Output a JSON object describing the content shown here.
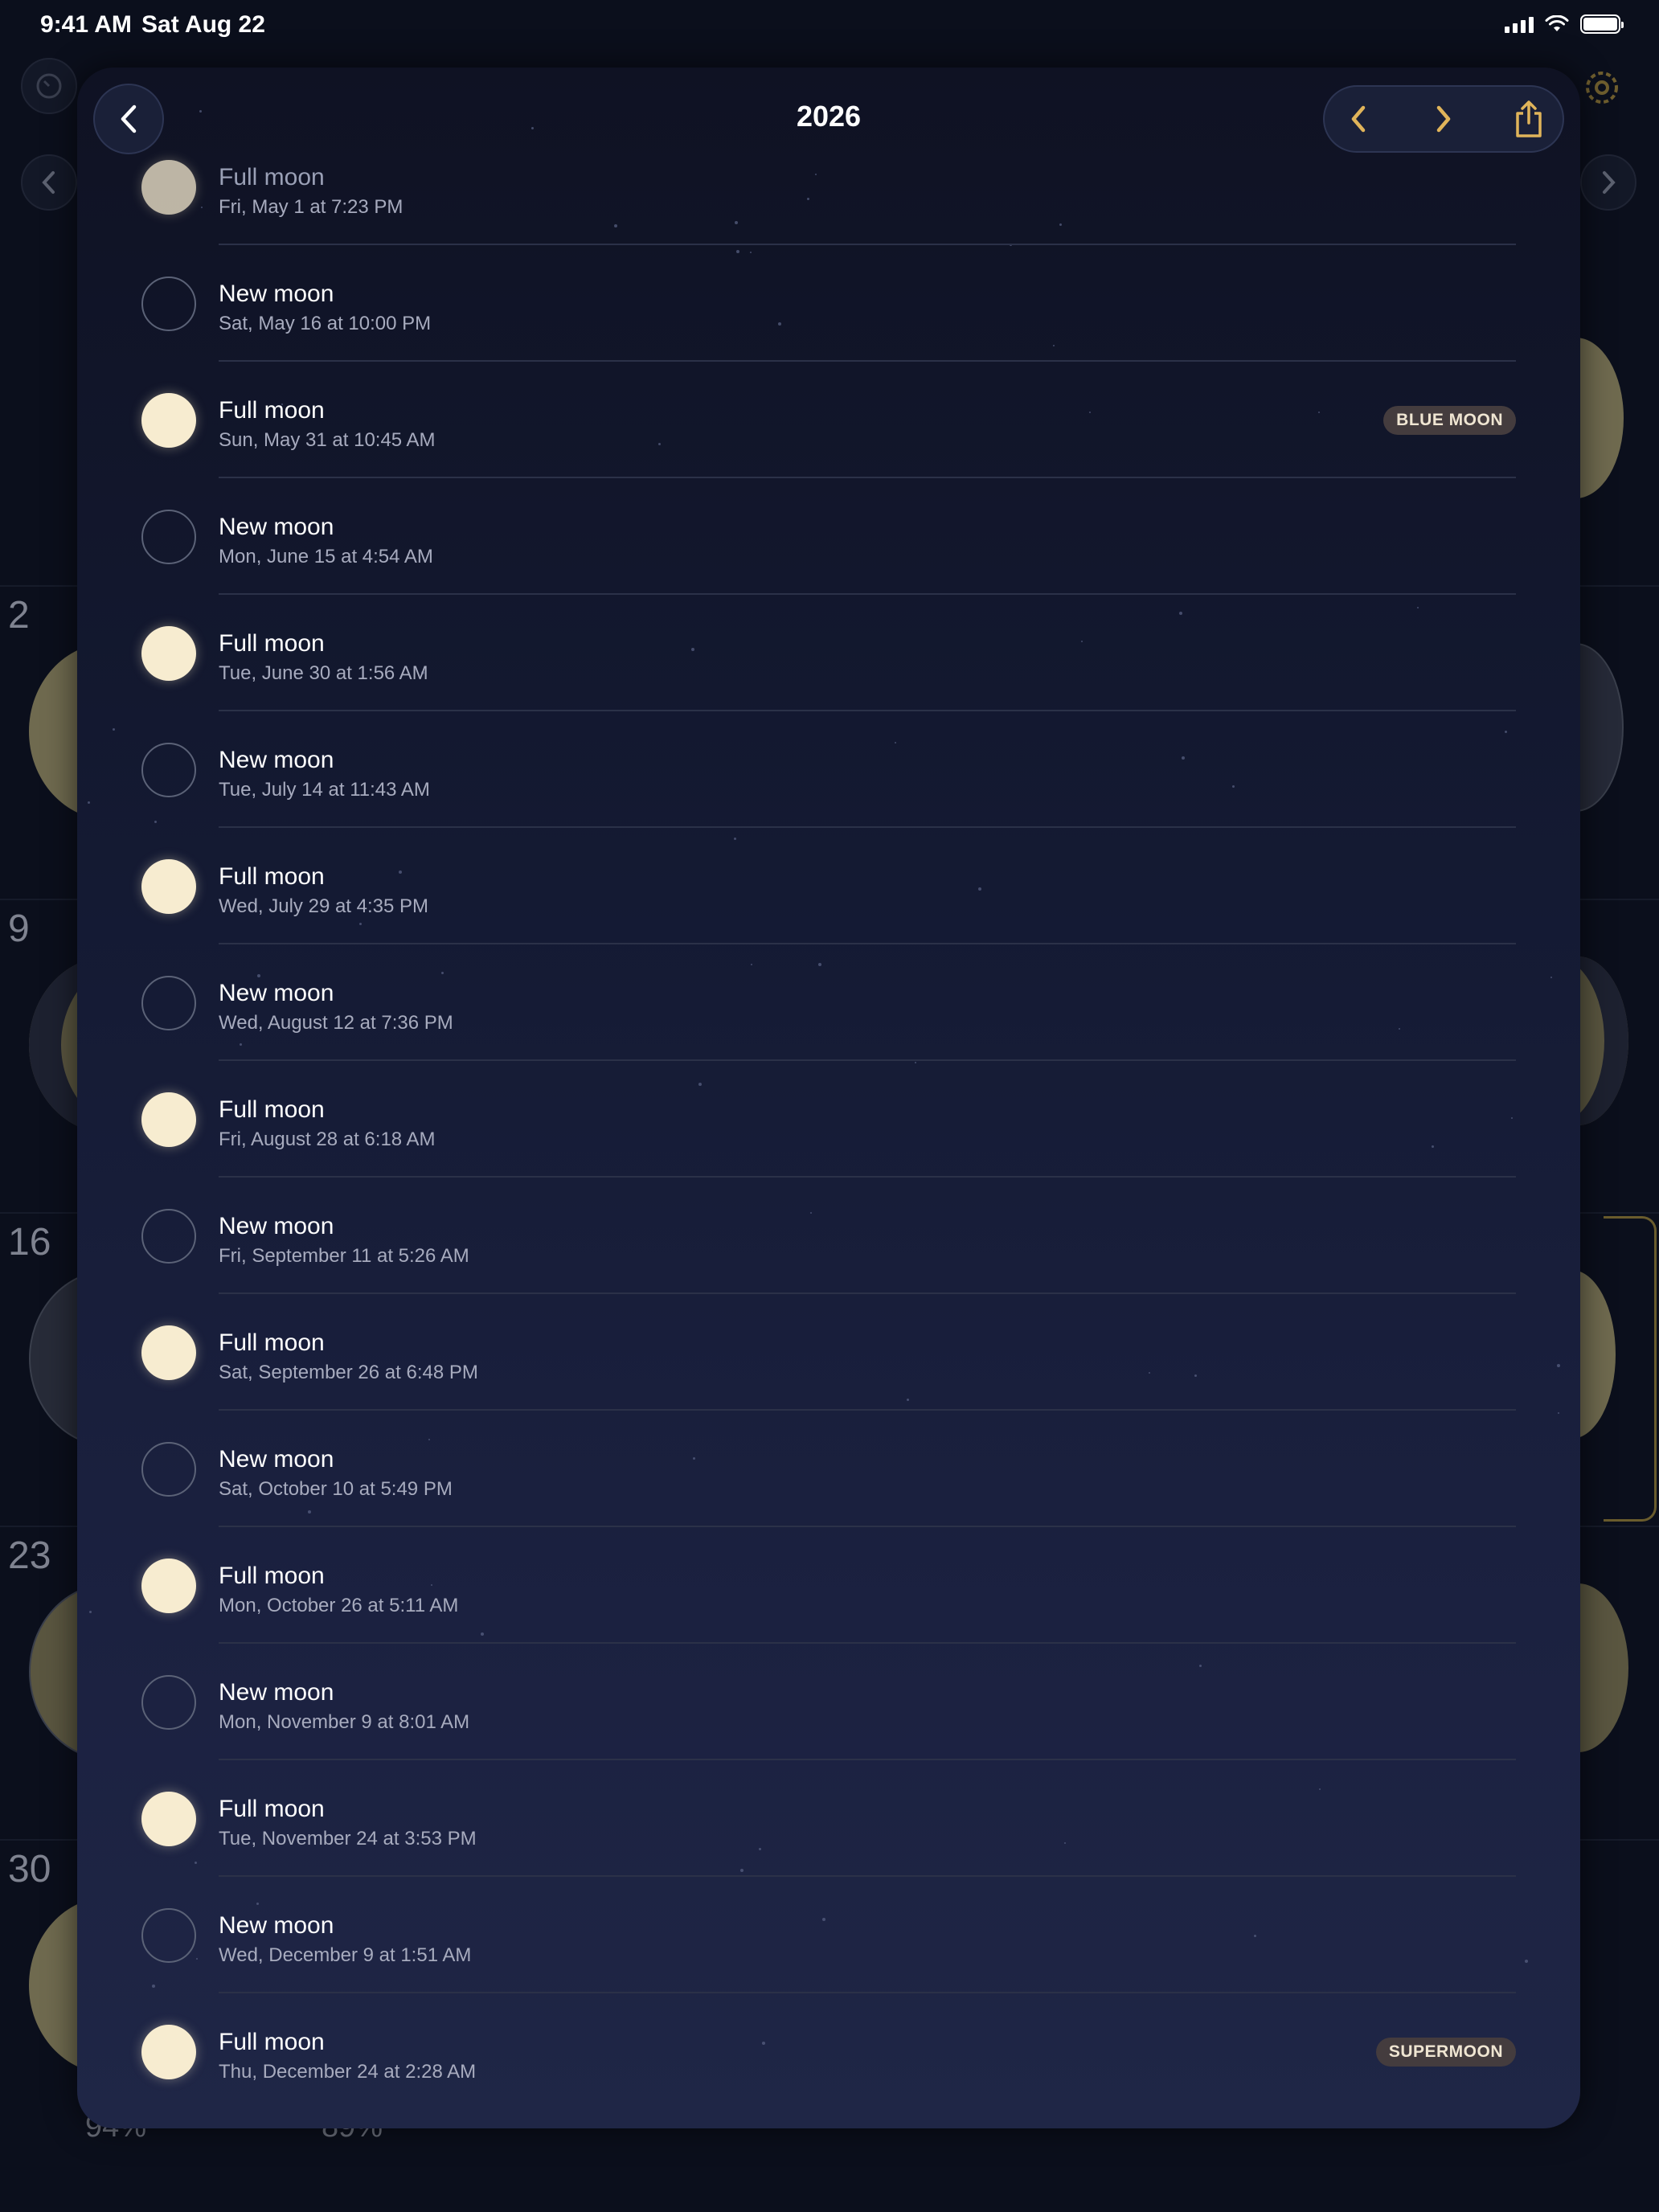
{
  "status_bar": {
    "time": "9:41 AM",
    "date": "Sat Aug 22"
  },
  "background_calendar": {
    "week_numbers": [
      "2",
      "9",
      "16",
      "23",
      "30"
    ],
    "percentages": [
      "94%",
      "89%"
    ]
  },
  "sheet": {
    "title": "2026",
    "back_label": "Back",
    "prev_label": "Previous year",
    "next_label": "Next year",
    "share_label": "Share"
  },
  "events": [
    {
      "phase": "Full moon",
      "when": "Fri, May 1 at 7:23 PM",
      "type": "full",
      "badge": ""
    },
    {
      "phase": "New moon",
      "when": "Sat, May 16 at 10:00 PM",
      "type": "new",
      "badge": ""
    },
    {
      "phase": "Full moon",
      "when": "Sun, May 31 at 10:45 AM",
      "type": "full",
      "badge": "BLUE MOON"
    },
    {
      "phase": "New moon",
      "when": "Mon, June 15 at 4:54 AM",
      "type": "new",
      "badge": ""
    },
    {
      "phase": "Full moon",
      "when": "Tue, June 30 at 1:56 AM",
      "type": "full",
      "badge": ""
    },
    {
      "phase": "New moon",
      "when": "Tue, July 14 at 11:43 AM",
      "type": "new",
      "badge": ""
    },
    {
      "phase": "Full moon",
      "when": "Wed, July 29 at 4:35 PM",
      "type": "full",
      "badge": ""
    },
    {
      "phase": "New moon",
      "when": "Wed, August 12 at 7:36 PM",
      "type": "new",
      "badge": ""
    },
    {
      "phase": "Full moon",
      "when": "Fri, August 28 at 6:18 AM",
      "type": "full",
      "badge": ""
    },
    {
      "phase": "New moon",
      "when": "Fri, September 11 at 5:26 AM",
      "type": "new",
      "badge": ""
    },
    {
      "phase": "Full moon",
      "when": "Sat, September 26 at 6:48 PM",
      "type": "full",
      "badge": ""
    },
    {
      "phase": "New moon",
      "when": "Sat, October 10 at 5:49 PM",
      "type": "new",
      "badge": ""
    },
    {
      "phase": "Full moon",
      "when": "Mon, October 26 at 5:11 AM",
      "type": "full",
      "badge": ""
    },
    {
      "phase": "New moon",
      "when": "Mon, November 9 at 8:01 AM",
      "type": "new",
      "badge": ""
    },
    {
      "phase": "Full moon",
      "when": "Tue, November 24 at 3:53 PM",
      "type": "full",
      "badge": ""
    },
    {
      "phase": "New moon",
      "when": "Wed, December 9 at 1:51 AM",
      "type": "new",
      "badge": ""
    },
    {
      "phase": "Full moon",
      "when": "Thu, December 24 at 2:28 AM",
      "type": "full",
      "badge": "SUPERMOON"
    }
  ]
}
